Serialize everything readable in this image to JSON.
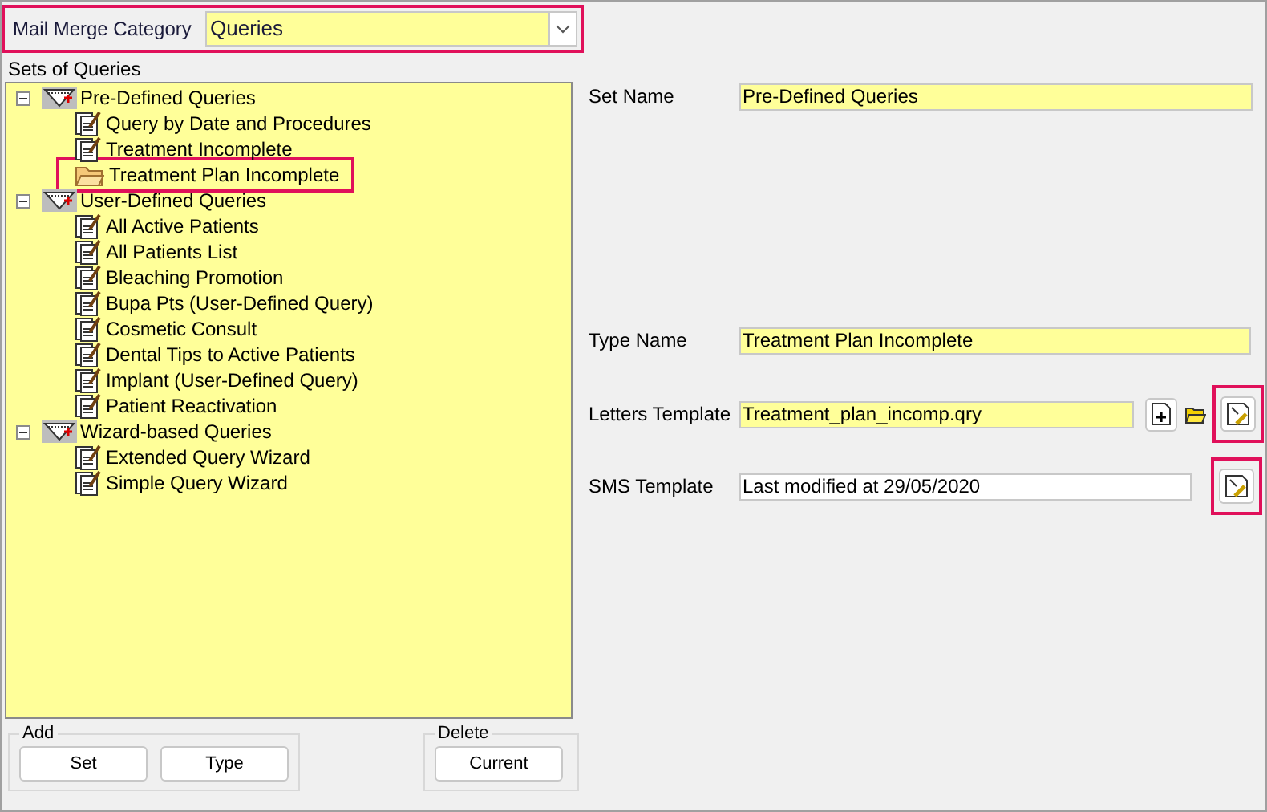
{
  "category": {
    "label": "Mail Merge Category",
    "value": "Queries",
    "highlighted": true
  },
  "sets_label": "Sets of Queries",
  "tree": [
    {
      "kind": "group",
      "label": "Pre-Defined Queries",
      "expanded": true,
      "children": [
        {
          "kind": "query",
          "label": "Query by Date and Procedures",
          "highlighted": false
        },
        {
          "kind": "query",
          "label": "Treatment Incomplete",
          "highlighted": false
        },
        {
          "kind": "folder",
          "label": "Treatment Plan Incomplete",
          "highlighted": true
        }
      ]
    },
    {
      "kind": "group",
      "label": "User-Defined Queries",
      "expanded": true,
      "children": [
        {
          "kind": "query",
          "label": "All Active Patients",
          "highlighted": false
        },
        {
          "kind": "query",
          "label": "All Patients List",
          "highlighted": false
        },
        {
          "kind": "query",
          "label": "Bleaching Promotion",
          "highlighted": false
        },
        {
          "kind": "query",
          "label": "Bupa Pts (User-Defined Query)",
          "highlighted": false
        },
        {
          "kind": "query",
          "label": "Cosmetic Consult",
          "highlighted": false
        },
        {
          "kind": "query",
          "label": "Dental Tips to Active Patients",
          "highlighted": false
        },
        {
          "kind": "query",
          "label": "Implant (User-Defined Query)",
          "highlighted": false
        },
        {
          "kind": "query",
          "label": "Patient Reactivation",
          "highlighted": false
        }
      ]
    },
    {
      "kind": "group",
      "label": "Wizard-based Queries",
      "expanded": true,
      "children": [
        {
          "kind": "query",
          "label": "Extended Query Wizard",
          "highlighted": false
        },
        {
          "kind": "query",
          "label": "Simple Query Wizard",
          "highlighted": false
        }
      ]
    }
  ],
  "set_name": {
    "label": "Set Name",
    "value": "Pre-Defined Queries"
  },
  "type_name": {
    "label": "Type Name",
    "value": "Treatment Plan Incomplete"
  },
  "letters_template": {
    "label": "Letters Template",
    "value": "Treatment_plan_incomp.qry",
    "edit_highlighted": true
  },
  "sms_template": {
    "label": "SMS Template",
    "value": "Last modified at 29/05/2020",
    "edit_highlighted": true
  },
  "add_group": {
    "label": "Add",
    "buttons": [
      "Set",
      "Type"
    ]
  },
  "delete_group": {
    "label": "Delete",
    "buttons": [
      "Current"
    ]
  }
}
